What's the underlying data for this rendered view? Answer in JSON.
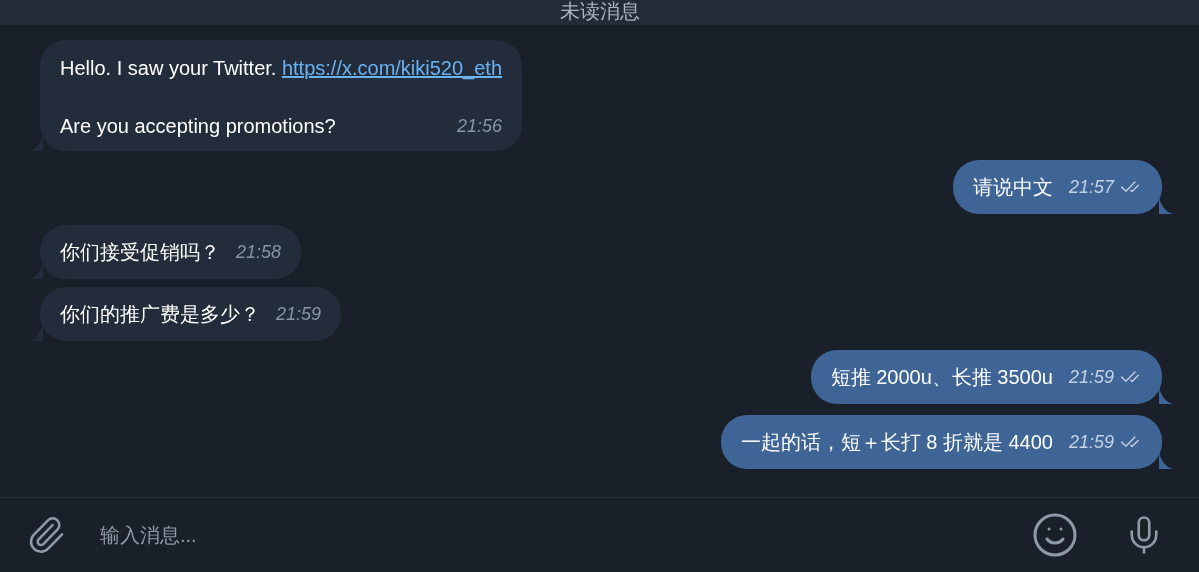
{
  "banner": {
    "title": "未读消息"
  },
  "messages": [
    {
      "kind": "incoming",
      "lines": [
        [
          {
            "kind": "text",
            "text": "Hello. I saw your Twitter. "
          },
          {
            "kind": "link",
            "text": "https://x.com/kiki520_eth"
          }
        ],
        [
          {
            "kind": "text",
            "text": "Are you accepting promotions?"
          }
        ]
      ],
      "time": "21:56"
    },
    {
      "kind": "outgoing",
      "lines": [
        [
          {
            "kind": "text",
            "text": "请说中文"
          }
        ]
      ],
      "time": "21:57",
      "read": true
    },
    {
      "kind": "incoming",
      "lines": [
        [
          {
            "kind": "text",
            "text": "你们接受促销吗？"
          }
        ]
      ],
      "time": "21:58"
    },
    {
      "kind": "incoming",
      "lines": [
        [
          {
            "kind": "text",
            "text": "你们的推广费是多少？"
          }
        ]
      ],
      "time": "21:59"
    },
    {
      "kind": "outgoing",
      "lines": [
        [
          {
            "kind": "text",
            "text": "短推 2000u、长推 3500u"
          }
        ]
      ],
      "time": "21:59",
      "read": true
    },
    {
      "kind": "outgoing",
      "lines": [
        [
          {
            "kind": "text",
            "text": "一起的话，短＋长打 8 折就是 4400"
          }
        ]
      ],
      "time": "21:59",
      "read": true
    }
  ],
  "composer": {
    "placeholder": "输入消息..."
  }
}
